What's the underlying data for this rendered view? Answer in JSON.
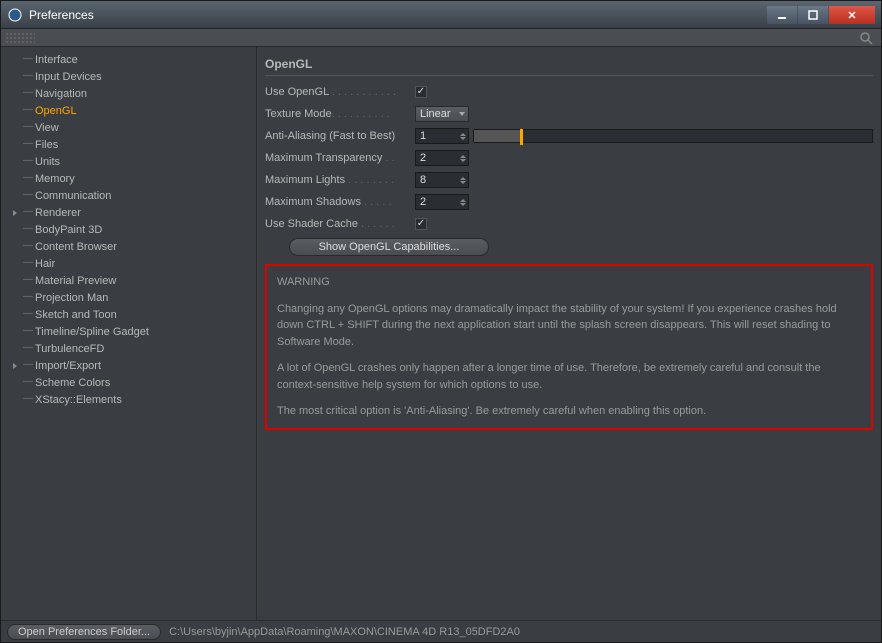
{
  "window": {
    "title": "Preferences"
  },
  "sidebar": {
    "items": [
      {
        "label": "Interface",
        "active": false
      },
      {
        "label": "Input Devices",
        "active": false
      },
      {
        "label": "Navigation",
        "active": false
      },
      {
        "label": "OpenGL",
        "active": true
      },
      {
        "label": "View",
        "active": false
      },
      {
        "label": "Files",
        "active": false
      },
      {
        "label": "Units",
        "active": false
      },
      {
        "label": "Memory",
        "active": false
      },
      {
        "label": "Communication",
        "active": false
      },
      {
        "label": "Renderer",
        "active": false,
        "expandable": true
      },
      {
        "label": "BodyPaint 3D",
        "active": false
      },
      {
        "label": "Content Browser",
        "active": false
      },
      {
        "label": "Hair",
        "active": false
      },
      {
        "label": "Material Preview",
        "active": false
      },
      {
        "label": "Projection Man",
        "active": false
      },
      {
        "label": "Sketch and Toon",
        "active": false
      },
      {
        "label": "Timeline/Spline Gadget",
        "active": false
      },
      {
        "label": "TurbulenceFD",
        "active": false
      },
      {
        "label": "Import/Export",
        "active": false,
        "expandable": true
      },
      {
        "label": "Scheme Colors",
        "active": false
      },
      {
        "label": "XStacy::Elements",
        "active": false
      }
    ]
  },
  "panel": {
    "title": "OpenGL",
    "use_opengl": {
      "label": "Use OpenGL",
      "checked": true
    },
    "texture_mode": {
      "label": "Texture Mode",
      "value": "Linear"
    },
    "anti_aliasing": {
      "label": "Anti-Aliasing (Fast to Best)",
      "value": "1"
    },
    "max_transparency": {
      "label": "Maximum Transparency",
      "value": "2"
    },
    "max_lights": {
      "label": "Maximum Lights",
      "value": "8"
    },
    "max_shadows": {
      "label": "Maximum Shadows",
      "value": "2"
    },
    "shader_cache": {
      "label": "Use Shader Cache",
      "checked": true
    },
    "capabilities_btn": "Show OpenGL Capabilities..."
  },
  "warning": {
    "heading": "WARNING",
    "p1": "Changing any OpenGL options may dramatically impact the stability of your system! If you experience crashes hold down CTRL + SHIFT during the next application start until the splash screen disappears. This will reset shading to Software Mode.",
    "p2": "A lot of OpenGL crashes only happen after a longer time of use. Therefore, be extremely careful and consult the context-sensitive help system for which options to use.",
    "p3": "The most critical option is 'Anti-Aliasing'. Be extremely careful when enabling this option."
  },
  "statusbar": {
    "open_folder_btn": "Open Preferences Folder...",
    "path": "C:\\Users\\byjin\\AppData\\Roaming\\MAXON\\CINEMA 4D R13_05DFD2A0"
  }
}
